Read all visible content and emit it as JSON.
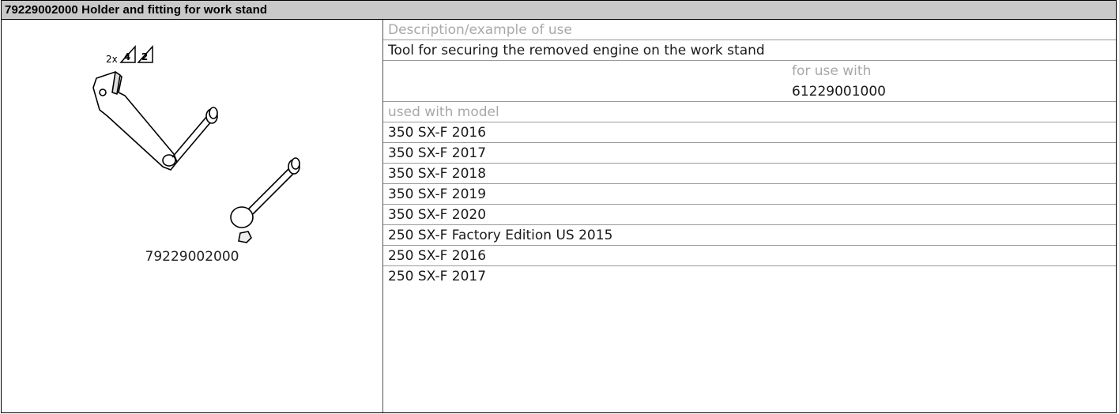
{
  "header": {
    "title": "79229002000 Holder and fitting for work stand"
  },
  "image_panel": {
    "quantity_label": "2x",
    "warning_numbers": [
      "4",
      "2"
    ],
    "part_number_caption": "79229002000"
  },
  "details": {
    "description_label": "Description/example of use",
    "description_text": "Tool for securing the removed engine on the work stand",
    "for_use_with_label": "for use with",
    "for_use_with_value": "61229001000",
    "used_with_model_label": "used with model",
    "models": [
      "350 SX-F 2016",
      "350 SX-F 2017",
      "350 SX-F 2018",
      "350 SX-F 2019",
      "350 SX-F 2020",
      "250 SX-F Factory Edition US 2015",
      "250 SX-F 2016",
      "250 SX-F 2017"
    ]
  }
}
